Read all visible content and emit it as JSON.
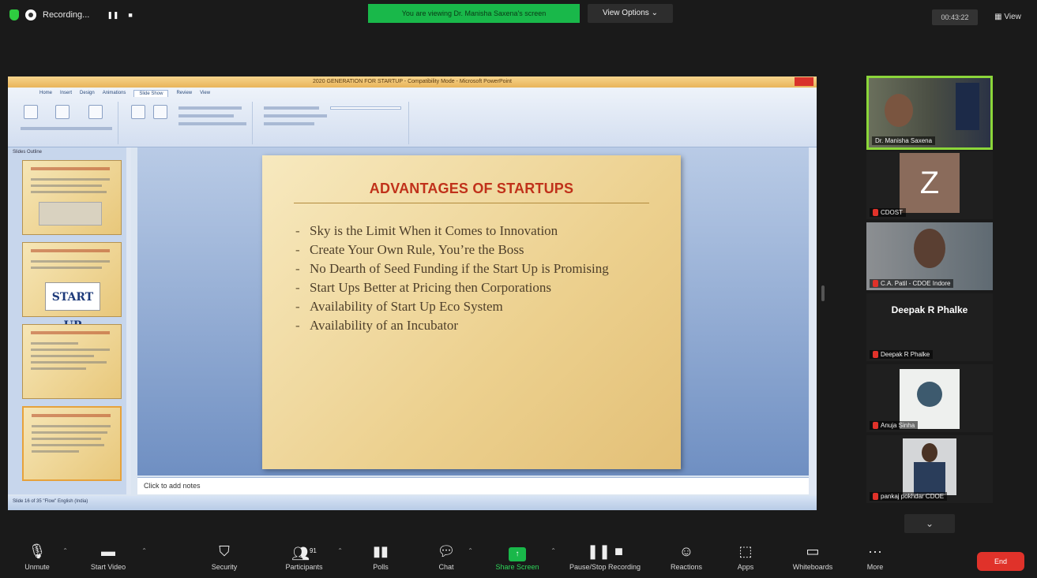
{
  "topbar": {
    "recording_label": "Recording...",
    "viewing_banner": "You are viewing Dr. Manisha Saxena's screen",
    "view_options_label": "View Options",
    "timer": "00:43:22",
    "view_label": "View"
  },
  "powerpoint": {
    "title": "2020 GENERATION FOR STARTUP - Compatibility Mode - Microsoft PowerPoint",
    "ribbon_tabs": [
      "Home",
      "Insert",
      "Design",
      "Animations",
      "Slide Show",
      "Review",
      "View"
    ],
    "panel_tabs": "Slides   Outline",
    "thumbnail_image_text": "START UP",
    "notes_placeholder": "Click to add notes",
    "status_text": "Slide 16 of 35   \"Flow\"   English (India)"
  },
  "slide": {
    "title": "ADVANTAGES OF STARTUPS",
    "bullets": [
      "Sky is the Limit When it Comes to Innovation",
      "Create Your Own Rule, You’re the Boss",
      "No Dearth of Seed Funding if the Start Up is Promising",
      "Start Ups Better at Pricing then Corporations",
      "Availability of Start Up Eco System",
      "Availability of an Incubator"
    ]
  },
  "participants": [
    {
      "name": "Dr. Manisha Saxena",
      "video": true
    },
    {
      "name": "CDOST",
      "avatar_letter": "Z",
      "muted": true
    },
    {
      "name": "C.A. Patil - CDOE Indore",
      "video": true,
      "muted": true
    },
    {
      "name": "Deepak R Phalke",
      "display_name": "Deepak R Phalke",
      "muted": true
    },
    {
      "name": "Anuja Sinha",
      "video": true,
      "muted": true
    },
    {
      "name": "pankaj pokhdar CDOE",
      "video": true,
      "muted": true
    }
  ],
  "toolbar": {
    "unmute": "Unmute",
    "start_video": "Start Video",
    "security": "Security",
    "participants": "Participants",
    "participants_count": "91",
    "polls": "Polls",
    "chat": "Chat",
    "share_screen": "Share Screen",
    "pause_recording": "Pause/Stop Recording",
    "reactions": "Reactions",
    "apps": "Apps",
    "whiteboards": "Whiteboards",
    "more": "More",
    "end": "End"
  },
  "colors": {
    "accent_green": "#19b84a",
    "end_red": "#e0322a",
    "slide_title_red": "#c0311a",
    "active_speaker_border": "#8bd63a"
  }
}
